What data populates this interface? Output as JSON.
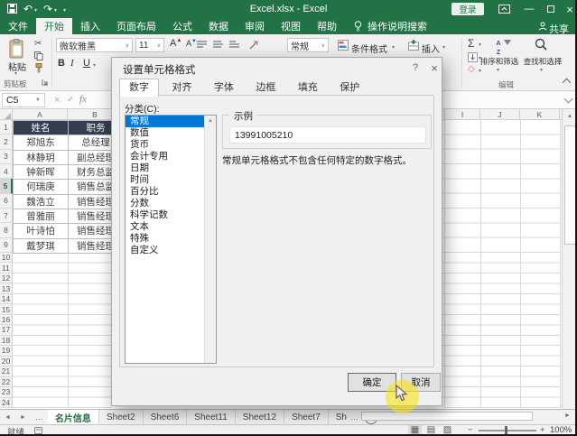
{
  "titlebar": {
    "title": "Excel.xlsx - Excel",
    "sign_in": "登录"
  },
  "ribbon_tabs": {
    "items": [
      "文件",
      "开始",
      "插入",
      "页面布局",
      "公式",
      "数据",
      "审阅",
      "视图",
      "帮助"
    ],
    "active": "开始",
    "search_hint": "操作说明搜索",
    "share": "共享"
  },
  "ribbon": {
    "paste_label": "粘贴",
    "clipboard_group_label": "剪贴板",
    "font_name": "微软雅黑",
    "font_size": "11",
    "bold": "B",
    "italic": "I",
    "underline": "U",
    "grow_font": "A",
    "shrink_font": "A",
    "number_format_value": "常规",
    "conditional_label": "条件格式",
    "insert_label": "插入",
    "sort_filter_label": "排序和筛选",
    "find_select_label": "查找和选择",
    "editing_group_label": "编辑",
    "az_a": "A",
    "az_z": "Z"
  },
  "formula_bar": {
    "name_box_value": "C5",
    "fx_label": "fx"
  },
  "sheet": {
    "columns_left": [
      "A",
      "B"
    ],
    "columns_right": [
      "I",
      "J",
      "K"
    ],
    "row_numbers": [
      "1",
      "2",
      "3",
      "4",
      "5",
      "6",
      "7",
      "8",
      "9",
      "10",
      "11",
      "12",
      "13",
      "14",
      "15",
      "16",
      "17",
      "18",
      "19",
      "20",
      "21",
      "22",
      "23",
      "24"
    ],
    "selected_row": "5",
    "table": {
      "headers": [
        "姓名",
        "职务"
      ],
      "rows": [
        [
          "郑旭东",
          "总经理"
        ],
        [
          "林静玥",
          "副总经理"
        ],
        [
          "钟新晖",
          "财务总监"
        ],
        [
          "何瑞庚",
          "销售总监"
        ],
        [
          "魏浩立",
          "销售经理"
        ],
        [
          "曾雅丽",
          "销售经理"
        ],
        [
          "叶诗怕",
          "销售经理"
        ],
        [
          "戴梦琪",
          "销售经理"
        ]
      ]
    }
  },
  "dialog": {
    "title": "设置单元格格式",
    "help": "?",
    "close": "×",
    "tabs": [
      "数字",
      "对齐",
      "字体",
      "边框",
      "填充",
      "保护"
    ],
    "active_tab": "数字",
    "category_label": "分类(C):",
    "categories": [
      "常规",
      "数值",
      "货币",
      "会计专用",
      "日期",
      "时间",
      "百分比",
      "分数",
      "科学记数",
      "文本",
      "特殊",
      "自定义"
    ],
    "selected_category": "常规",
    "sample_label": "示例",
    "sample_value": "13991005210",
    "description": "常规单元格格式不包含任何特定的数字格式。",
    "ok_label": "确定",
    "cancel_label": "取消"
  },
  "sheet_tabs": {
    "items": [
      "名片信息",
      "Sheet2",
      "Sheet6",
      "Sheet11",
      "Sheet12",
      "Sheet7",
      "Sh"
    ],
    "active": "名片信息",
    "overflow_left": "…",
    "overflow_right": "…",
    "add_sheet": "+"
  },
  "status_bar": {
    "ready_label": "就绪",
    "zoom_out": "−",
    "zoom_in": "+",
    "zoom_level": "100%"
  },
  "icons": {
    "dropdown": "∨",
    "menu_arrow": "▾",
    "scroll_up": "▲",
    "scroll_right": "►",
    "nav_left": "◄",
    "nav_right": "►",
    "sigma": "Σ",
    "cut": "✂",
    "check": "✓",
    "close": "×",
    "minimize": "—",
    "undo": "↶",
    "redo": "↷",
    "clear": "◇",
    "normal_view": "▦",
    "page_layout_view": "▤",
    "page_break_view": "▨"
  },
  "colors": {
    "excel_green": "#217346",
    "selection_blue": "#0078d7",
    "table_header_bg": "#333f50"
  }
}
